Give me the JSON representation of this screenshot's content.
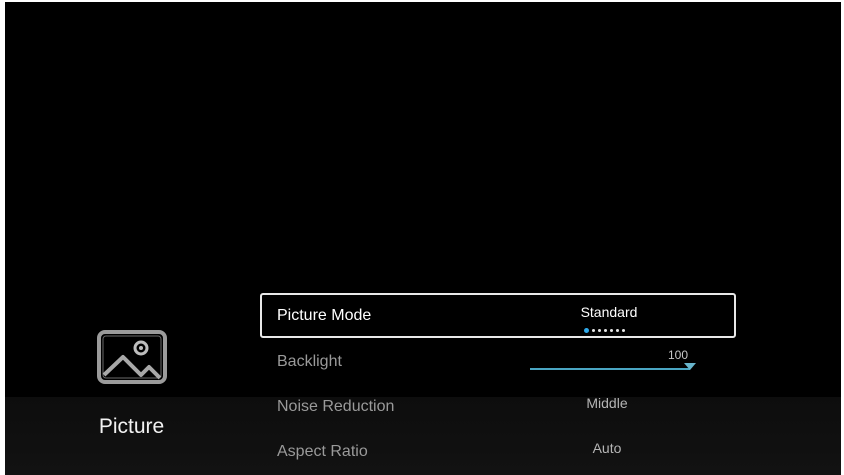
{
  "side_panel": {
    "icon": "picture-icon",
    "label": "Picture"
  },
  "menu": {
    "items": [
      {
        "label": "Picture Mode",
        "value": "Standard",
        "option_count": 7,
        "selected_option_index": 0,
        "selected": true
      },
      {
        "label": "Backlight",
        "value": "100",
        "slider_fraction": 1.0
      },
      {
        "label": "Noise Reduction",
        "value": "Middle"
      },
      {
        "label": "Aspect Ratio",
        "value": "Auto"
      }
    ]
  },
  "colors": {
    "accent": "#2fa9ea",
    "slider": "#4aa6c3",
    "background": "#000000"
  }
}
